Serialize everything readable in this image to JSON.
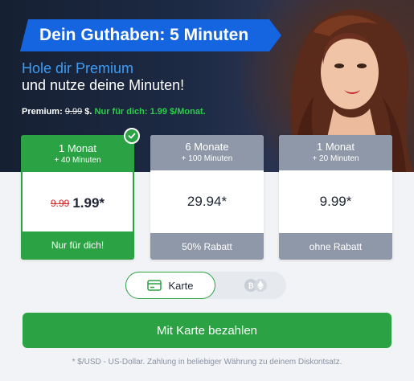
{
  "banner": {
    "title": "Dein Guthaben: 5 Minuten"
  },
  "hero": {
    "line1": "Hole dir Premium",
    "line2": "und nutze deine Minuten!",
    "premium_label": "Premium:",
    "premium_old": "9.99",
    "premium_currency": "$.",
    "premium_offer": "Nur für dich: 1.99 $/Monat."
  },
  "plans": [
    {
      "title": "1 Monat",
      "bonus": "+ 40 Minuten",
      "old_price": "9.99",
      "price": "1.99*",
      "tag": "Nur für dich!",
      "selected": true
    },
    {
      "title": "6 Monate",
      "bonus": "+ 100 Minuten",
      "price": "29.94*",
      "tag": "50% Rabatt",
      "selected": false
    },
    {
      "title": "1 Monat",
      "bonus": "+ 20 Minuten",
      "price": "9.99*",
      "tag": "ohne Rabatt",
      "selected": false
    }
  ],
  "payment_toggle": {
    "card_label": "Karte",
    "card_icon": "credit-card-icon",
    "crypto_icon": "crypto-coins-icon",
    "active": "card"
  },
  "pay_button": {
    "label": "Mit Karte bezahlen"
  },
  "footnote": "* $/USD - US-Dollar. Zahlung in beliebiger Währung zu deinem Diskontsatz.",
  "colors": {
    "accent_green": "#2ba243",
    "banner_blue": "#1565e0",
    "grey_plan": "#8f98a8",
    "old_price_red": "#d12a2a"
  }
}
